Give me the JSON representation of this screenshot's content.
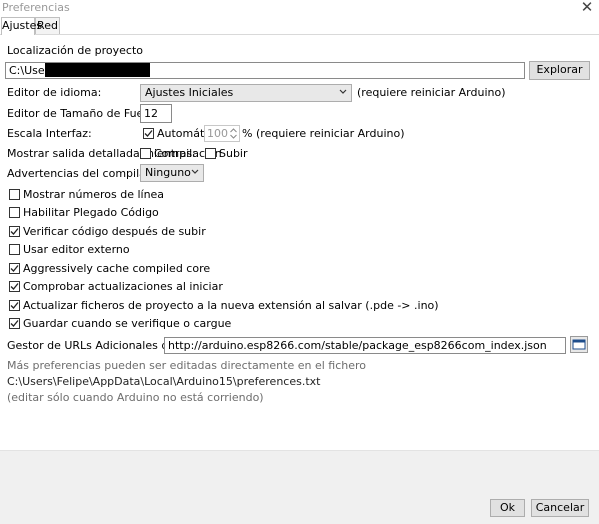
{
  "window": {
    "title": "Preferencias"
  },
  "tabs": [
    {
      "label": "Ajustes"
    },
    {
      "label": "Red"
    }
  ],
  "sketchbook": {
    "label": "Localización de proyecto",
    "path_prefix": "C:\\Users",
    "browse_label": "Explorar"
  },
  "language": {
    "label": "Editor de idioma:",
    "value": "Ajustes Iniciales",
    "note": "(requiere reiniciar Arduino)"
  },
  "font_size": {
    "label": "Editor de Tamaño de Fuente:",
    "value": "12"
  },
  "scale": {
    "label": "Escala Interfaz:",
    "auto_label": "Automático",
    "value": "100",
    "unit": "%",
    "note": "(requiere reiniciar Arduino)"
  },
  "verbose": {
    "label": "Mostrar salida detallada mientras:",
    "compile_label": "Compilación",
    "upload_label": "Subir"
  },
  "warnings": {
    "label": "Advertencias del compilador:",
    "value": "Ninguno"
  },
  "options": [
    {
      "label": "Mostrar números de línea",
      "checked": false
    },
    {
      "label": "Habilitar Plegado Código",
      "checked": false
    },
    {
      "label": "Verificar código después de subir",
      "checked": true
    },
    {
      "label": "Usar editor externo",
      "checked": false
    },
    {
      "label": "Aggressively cache compiled core",
      "checked": true
    },
    {
      "label": "Comprobar actualizaciones al iniciar",
      "checked": true
    },
    {
      "label": "Actualizar ficheros de proyecto a la nueva extensión al salvar (.pde -> .ino)",
      "checked": true
    },
    {
      "label": "Guardar cuando se verifique o cargue",
      "checked": true
    }
  ],
  "board_urls": {
    "label": "Gestor de URLs Adicionales de Tarjetas:",
    "value": "http://arduino.esp8266.com/stable/package_esp8266com_index.json"
  },
  "info": {
    "line1": "Más preferencias pueden ser editadas directamente en el fichero",
    "line2": "C:\\Users\\Felipe\\AppData\\Local\\Arduino15\\preferences.txt",
    "line3": "(editar sólo cuando Arduino no está corriendo)"
  },
  "footer": {
    "ok_label": "Ok",
    "cancel_label": "Cancelar"
  }
}
